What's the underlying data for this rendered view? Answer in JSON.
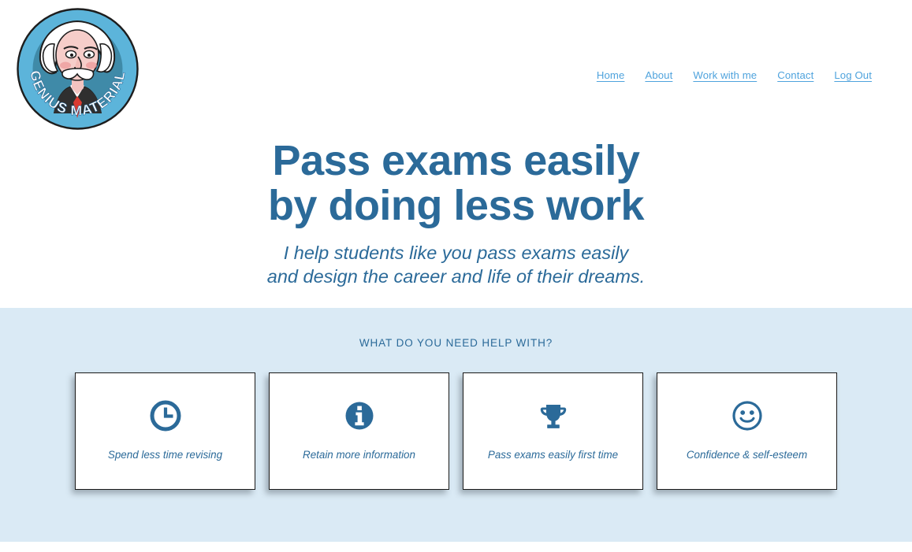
{
  "site": {
    "logo": {
      "alt": "Genius Material logo",
      "badge_text": "GENIUS MATERIAL",
      "ring_color": "#5cb4da",
      "inner_color": "#3f8aa8"
    }
  },
  "nav": {
    "items": [
      {
        "label": "Home",
        "name": "nav-link-home"
      },
      {
        "label": "About",
        "name": "nav-link-about"
      },
      {
        "label": "Work with me",
        "name": "nav-link-work-with-me"
      },
      {
        "label": "Contact",
        "name": "nav-link-contact"
      },
      {
        "label": "Log Out",
        "name": "nav-link-log-out"
      }
    ],
    "link_color": "#4fa3dd"
  },
  "hero": {
    "title_line1": "Pass exams easily",
    "title_line2": "by doing less work",
    "subtitle_line1": "I help students like you pass exams easily",
    "subtitle_line2": "and design the career and life of their dreams.",
    "text_color": "#2b6a99"
  },
  "help_section": {
    "heading": "WHAT DO YOU NEED HELP WITH?",
    "background": "#daeaf5",
    "cards": [
      {
        "label": "Spend less time revising",
        "icon": "clock-icon"
      },
      {
        "label": "Retain more information",
        "icon": "info-icon"
      },
      {
        "label": "Pass exams easily first time",
        "icon": "trophy-icon"
      },
      {
        "label": "Confidence & self-esteem",
        "icon": "smiley-icon"
      }
    ]
  },
  "colors": {
    "brand_blue": "#2b6a99",
    "icon_blue": "#2b6a99",
    "light_blue": "#daeaf5",
    "link_blue": "#4fa3dd"
  }
}
